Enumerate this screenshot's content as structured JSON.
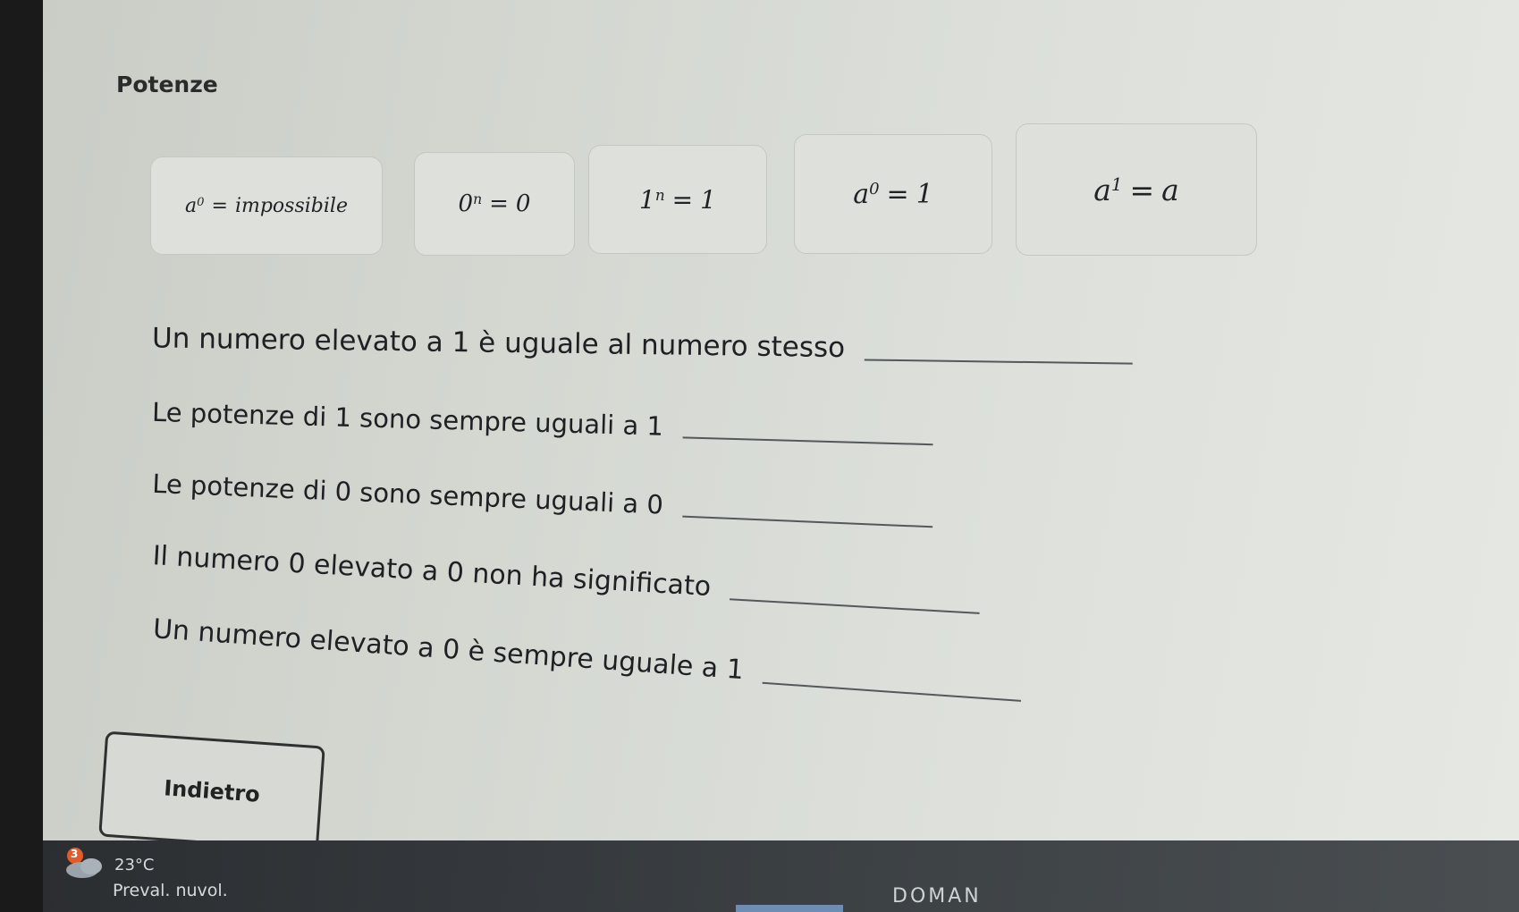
{
  "page": {
    "title": "Potenze"
  },
  "cards": [
    {
      "base": "a",
      "exp": "0",
      "rhs": "impossibile"
    },
    {
      "base": "0",
      "exp": "n",
      "rhs": "0"
    },
    {
      "base": "1",
      "exp": "n",
      "rhs": "1"
    },
    {
      "base": "a",
      "exp": "0",
      "rhs": "1"
    },
    {
      "base": "a",
      "exp": "1",
      "rhs": "a"
    }
  ],
  "statements": [
    "Un numero elevato a 1 è uguale al numero stesso",
    "Le potenze di 1 sono sempre uguali a 1",
    "Le potenze di 0 sono sempre uguali a 0",
    "Il numero 0 elevato a 0 non ha significato",
    "Un numero elevato a 0 è sempre uguale a 1"
  ],
  "back_button": {
    "label": "Indietro"
  },
  "taskbar": {
    "weather_badge": "3",
    "temperature": "23°C",
    "weather_desc": "Preval. nuvol.",
    "word": "DOMAN"
  },
  "colors": {
    "accent": "#6d8db3"
  }
}
